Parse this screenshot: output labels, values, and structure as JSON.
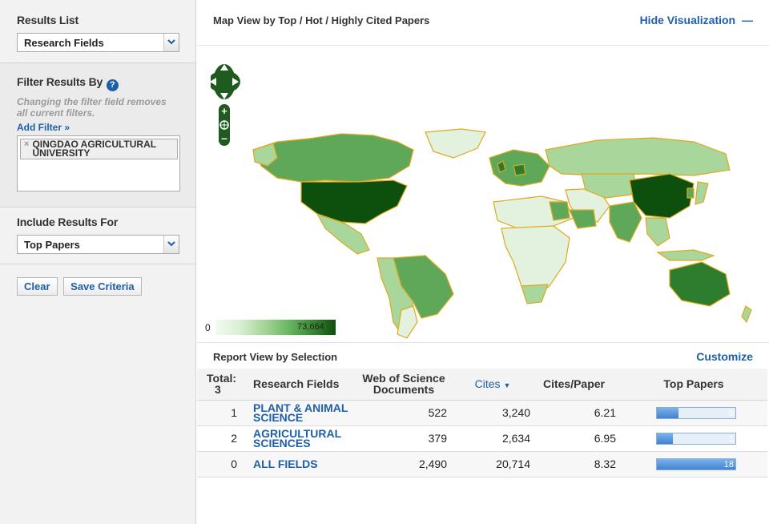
{
  "sidebar": {
    "results_list": {
      "title": "Results List",
      "selected": "Research Fields"
    },
    "filter": {
      "title": "Filter Results By",
      "hint": "Changing the filter field removes all current filters.",
      "add_filter": "Add Filter »",
      "chips": [
        "QINGDAO AGRICULTURAL UNIVERSITY"
      ]
    },
    "include": {
      "title": "Include Results For",
      "selected": "Top Papers"
    },
    "buttons": {
      "clear": "Clear",
      "save": "Save Criteria"
    }
  },
  "map": {
    "title": "Map View by Top / Hot / Highly Cited Papers",
    "hide": "Hide Visualization",
    "legend_min": "0",
    "legend_max": "73,664",
    "colors": {
      "darkest": "#0d4f0d",
      "dark": "#2e7d2e",
      "mid": "#5fa85a",
      "light": "#a8d69b",
      "lightest": "#e3f2de",
      "border": "#e0a81e"
    }
  },
  "report": {
    "title": "Report View by Selection",
    "customize": "Customize",
    "columns": {
      "total": "Total:",
      "total_count": "3",
      "field": "Research Fields",
      "wos": "Web of Science Documents",
      "cites": "Cites",
      "cites_per_paper": "Cites/Paper",
      "top_papers": "Top Papers"
    },
    "rows": [
      {
        "idx": "1",
        "field": "PLANT & ANIMAL SCIENCE",
        "wos": "522",
        "cites": "3,240",
        "cpp": "6.21",
        "top": "5",
        "top_fraction": 0.28
      },
      {
        "idx": "2",
        "field": "AGRICULTURAL SCIENCES",
        "wos": "379",
        "cites": "2,634",
        "cpp": "6.95",
        "top": "1",
        "top_fraction": 0.2
      },
      {
        "idx": "0",
        "field": "ALL FIELDS",
        "wos": "2,490",
        "cites": "20,714",
        "cpp": "8.32",
        "top": "18",
        "top_fraction": 1.0
      }
    ]
  }
}
